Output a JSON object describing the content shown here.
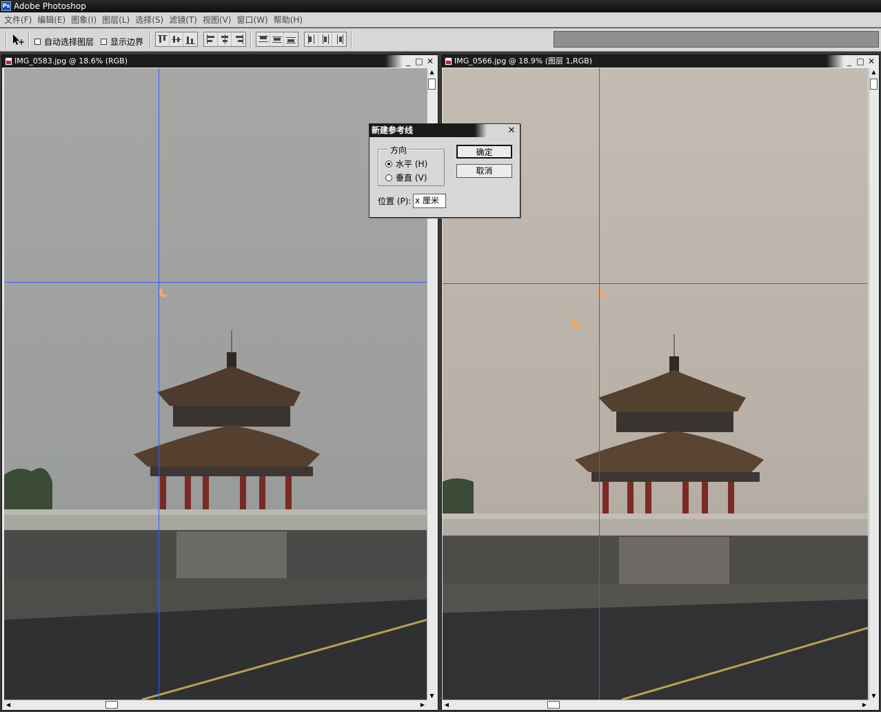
{
  "app": {
    "title": "Adobe Photoshop",
    "logo_text": "Ps"
  },
  "menu": [
    "文件(F)",
    "编辑(E)",
    "图象(I)",
    "图层(L)",
    "选择(S)",
    "滤镜(T)",
    "视图(V)",
    "窗口(W)",
    "帮助(H)"
  ],
  "options_bar": {
    "auto_select_layer": {
      "label": "自动选择图层",
      "checked": false
    },
    "show_bounds": {
      "label": "显示边界",
      "checked": false
    }
  },
  "documents": [
    {
      "title": "IMG_0583.jpg @ 18.6% (RGB)",
      "controls": [
        "_",
        "□",
        "✕"
      ]
    },
    {
      "title": "IMG_0566.jpg @ 18.9% (图层 1,RGB)",
      "controls": [
        "_",
        "□",
        "✕"
      ]
    }
  ],
  "dialog": {
    "title": "新建参考线",
    "close": "✕",
    "orientation": {
      "legend": "方向",
      "options": [
        {
          "label": "水平 (H)",
          "selected": true
        },
        {
          "label": "垂直 (V)",
          "selected": false
        }
      ]
    },
    "position": {
      "label": "位置 (P):",
      "value": "x 厘米"
    },
    "ok": "确定",
    "cancel": "取消"
  },
  "colors": {
    "guide": "#3a5bff",
    "sky_left": "#9ea19f",
    "sky_right": "#bdb5ab"
  }
}
